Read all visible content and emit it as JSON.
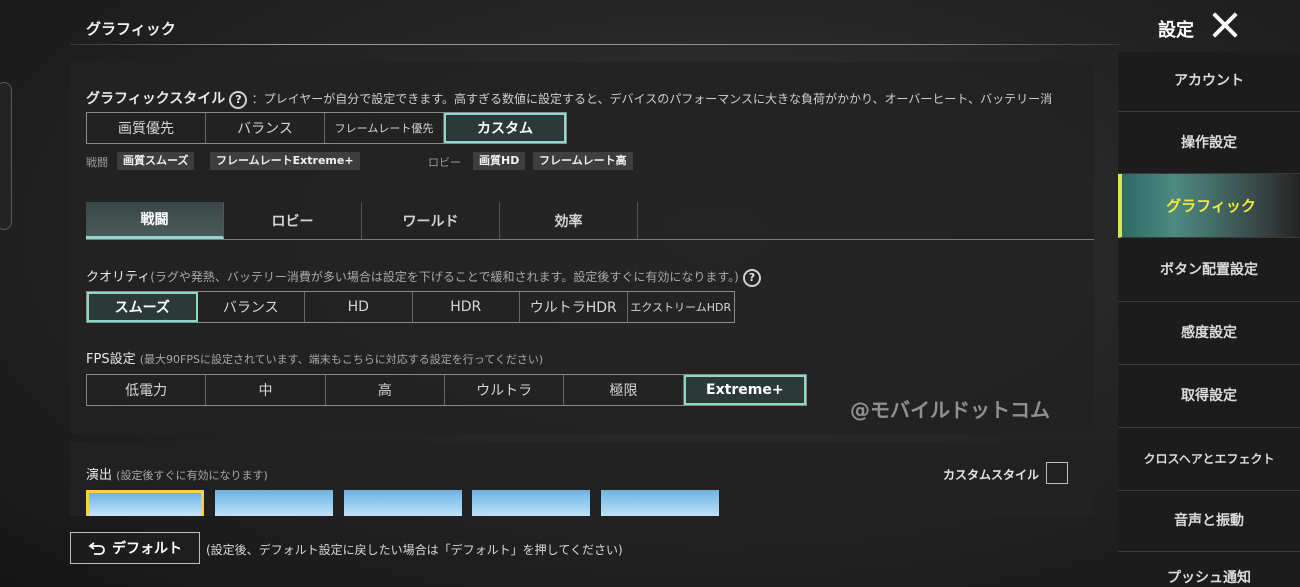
{
  "header": {
    "title": "グラフィック",
    "settings_title": "設定"
  },
  "graphic_style": {
    "label": "グラフィックスタイル",
    "help": "?",
    "description": "：プレイヤーが自分で設定できます。高すぎる数値に設定すると、デバイスのパフォーマンスに大きな負荷がかかり、オーバーヒート、バッテリー消",
    "options": [
      "画質優先",
      "バランス",
      "フレームレート優先",
      "カスタム"
    ],
    "selected": "カスタム"
  },
  "presets": {
    "battle_label": "戦闘",
    "battle_quality": "画質スムーズ",
    "battle_fps": "フレームレートExtreme+",
    "lobby_label": "ロビー",
    "lobby_quality": "画質HD",
    "lobby_fps": "フレームレート高"
  },
  "tabs": [
    "戦闘",
    "ロビー",
    "ワールド",
    "効率"
  ],
  "active_tab": "戦闘",
  "quality": {
    "label": "クオリティ",
    "note": "(ラグや発熱、バッテリー消費が多い場合は設定を下げることで緩和されます。設定後すぐに有効になります。)",
    "help": "?",
    "options": [
      "スムーズ",
      "バランス",
      "HD",
      "HDR",
      "ウルトラHDR",
      "エクストリームHDR"
    ],
    "selected": "スムーズ"
  },
  "fps": {
    "label": "FPS設定",
    "note": "(最大90FPSに設定されています、端末もこちらに対応する設定を行ってください)",
    "options": [
      "低電力",
      "中",
      "高",
      "ウルトラ",
      "極限",
      "Extreme+"
    ],
    "selected": "Extreme+"
  },
  "watermark": "@モバイルドットコム",
  "effects": {
    "label": "演出",
    "note": "(設定後すぐに有効になります)",
    "custom_style_label": "カスタムスタイル"
  },
  "footer": {
    "default_icon": "undo-arrow-icon",
    "default_label": "デフォルト",
    "note": "(設定後、デフォルト設定に戻したい場合は「デフォルト」を押してください)"
  },
  "sidebar": {
    "items": [
      "アカウント",
      "操作設定",
      "グラフィック",
      "ボタン配置設定",
      "感度設定",
      "取得設定",
      "クロスヘアとエフェクト",
      "音声と振動",
      "プッシュ通知"
    ],
    "active": "グラフィック"
  },
  "colors": {
    "accent": "#8fd6cc",
    "active_sidebar_text": "#f3ea3a",
    "thumb_selected": "#f3d43a"
  }
}
